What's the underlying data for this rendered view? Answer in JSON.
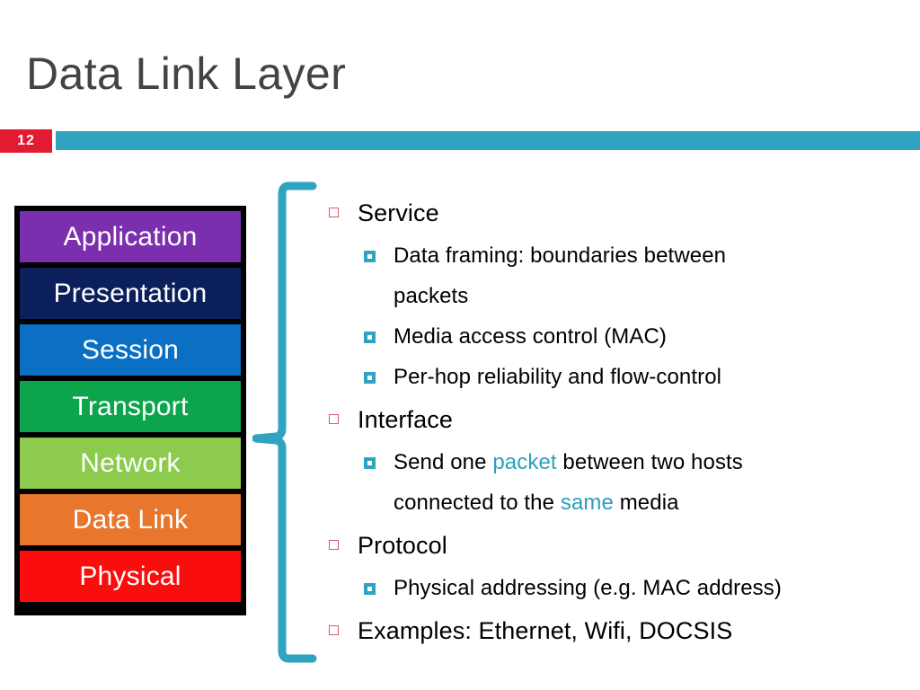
{
  "slide": {
    "title": "Data Link Layer",
    "number": "12",
    "accent_teal": "#2fa3c0",
    "badge_red": "#e21b33",
    "title_color": "#434343"
  },
  "osi_stack": {
    "name": "osi-layer-stack",
    "layers": [
      {
        "label": "Application",
        "bg": "#7b2fae",
        "fg": "#ffffff"
      },
      {
        "label": "Presentation",
        "bg": "#0a1f5c",
        "fg": "#ffffff"
      },
      {
        "label": "Session",
        "bg": "#0b6fc4",
        "fg": "#ffffff"
      },
      {
        "label": "Transport",
        "bg": "#0da54b",
        "fg": "#ffffff"
      },
      {
        "label": "Network",
        "bg": "#8ccb4e",
        "fg": "#ffffff"
      },
      {
        "label": "Data Link",
        "bg": "#e8762c",
        "fg": "#ffffff"
      },
      {
        "label": "Physical",
        "bg": "#fb0d0d",
        "fg": "#ffffff"
      }
    ]
  },
  "bullets": {
    "service": "Service",
    "service_sub_1_line_1": "Data framing: boundaries between",
    "service_sub_1_line_2": "packets",
    "service_sub_2": "Media access control (MAC)",
    "service_sub_3": "Per-hop reliability and flow-control",
    "interface": "Interface",
    "interface_sub_1_a": "Send one ",
    "interface_sub_1_hl1": "packet",
    "interface_sub_1_b": " between two hosts",
    "interface_sub_1_c": "connected to the ",
    "interface_sub_1_hl2": "same",
    "interface_sub_1_d": " media",
    "protocol": "Protocol",
    "protocol_sub_1": "Physical addressing (e.g. MAC address)",
    "examples": "Examples: Ethernet, Wifi, DOCSIS"
  }
}
